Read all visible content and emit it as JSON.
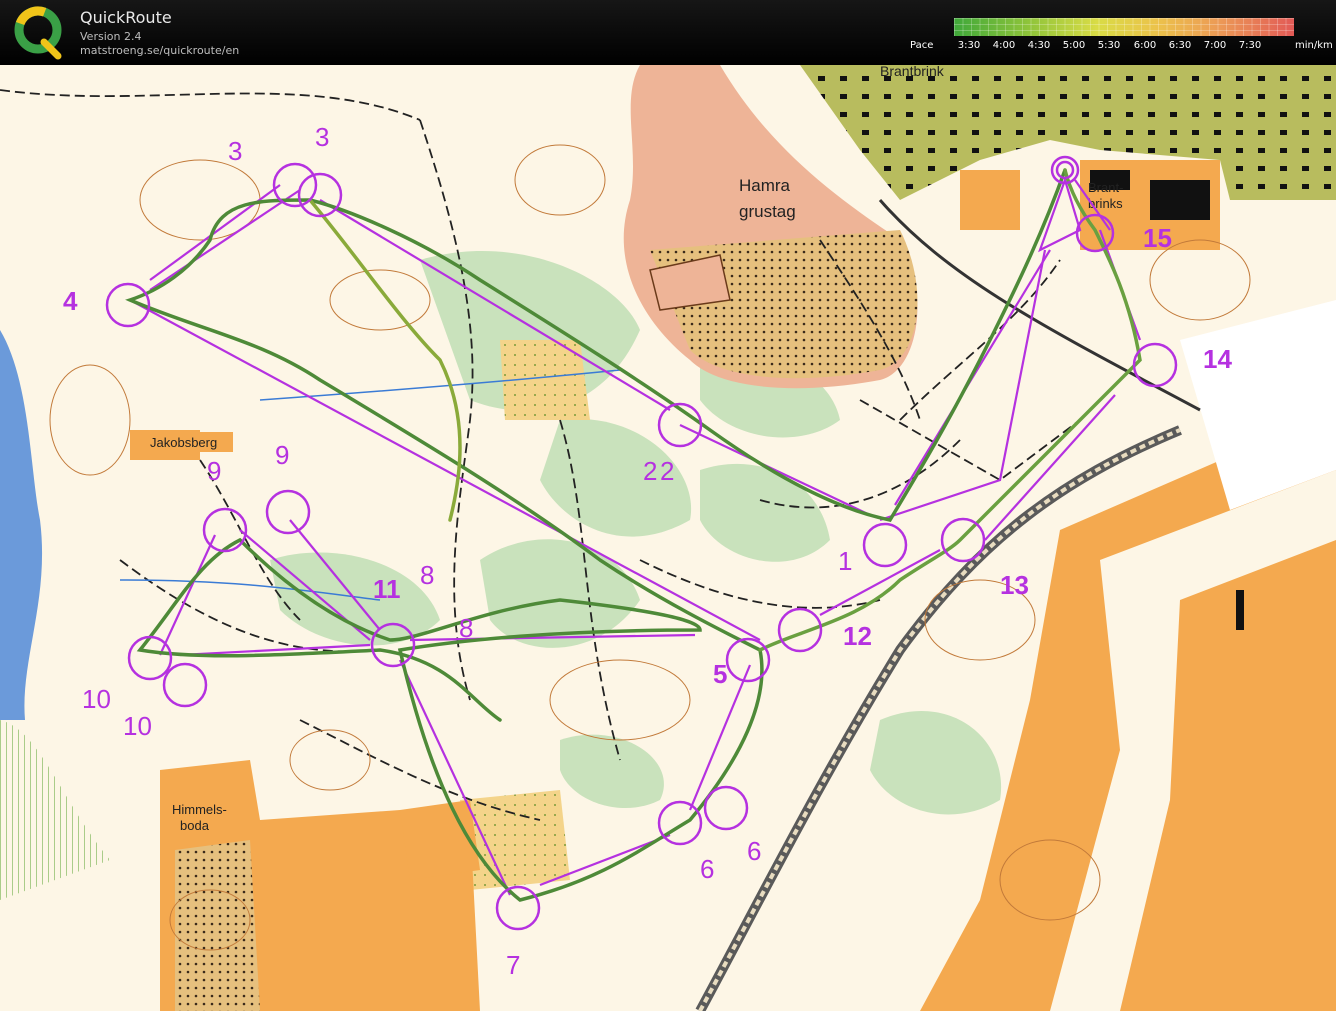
{
  "app": {
    "title": "QuickRoute",
    "version": "Version 2.4",
    "url": "matstroeng.se/quickroute/en"
  },
  "pace_legend": {
    "label": "Pace",
    "ticks": [
      "3:30",
      "4:00",
      "4:30",
      "5:00",
      "5:30",
      "6:00",
      "6:30",
      "7:00",
      "7:30"
    ],
    "unit": "min/km",
    "colors": [
      "#3fa83a",
      "#8fc43a",
      "#d9dc46",
      "#ecc24b",
      "#ec9a56",
      "#e25a56"
    ]
  },
  "map": {
    "place_names": {
      "hamra_line1": "Hamra",
      "hamra_line2": "grustag",
      "jakobsberg": "Jakobsberg",
      "himmelsboda_line1": "Himmels-",
      "himmelsboda_line2": "boda",
      "brantbrink_line1": "Brant-",
      "brantbrink_line2": "brinks",
      "brantbrink_top": "Brantbrink"
    },
    "controls": {
      "c1": "1",
      "c2": "2",
      "c2b": "2",
      "c3": "3",
      "c3b": "3",
      "c4": "4",
      "c5": "5",
      "c6": "6",
      "c6b": "6",
      "c7": "7",
      "c8": "8",
      "c8b": "8",
      "c9": "9",
      "c9b": "9",
      "c10": "10",
      "c10b": "10",
      "c11": "11",
      "c12": "12",
      "c13": "13",
      "c14": "14",
      "c15": "15"
    },
    "colors": {
      "course": "#b531e0",
      "route": "#4e8a38",
      "forest": "#fdf6e6",
      "green": "#c9e2bc",
      "open": "#f4a94f",
      "gravel": "#eeb497",
      "urban": "#b5ba5a"
    }
  }
}
